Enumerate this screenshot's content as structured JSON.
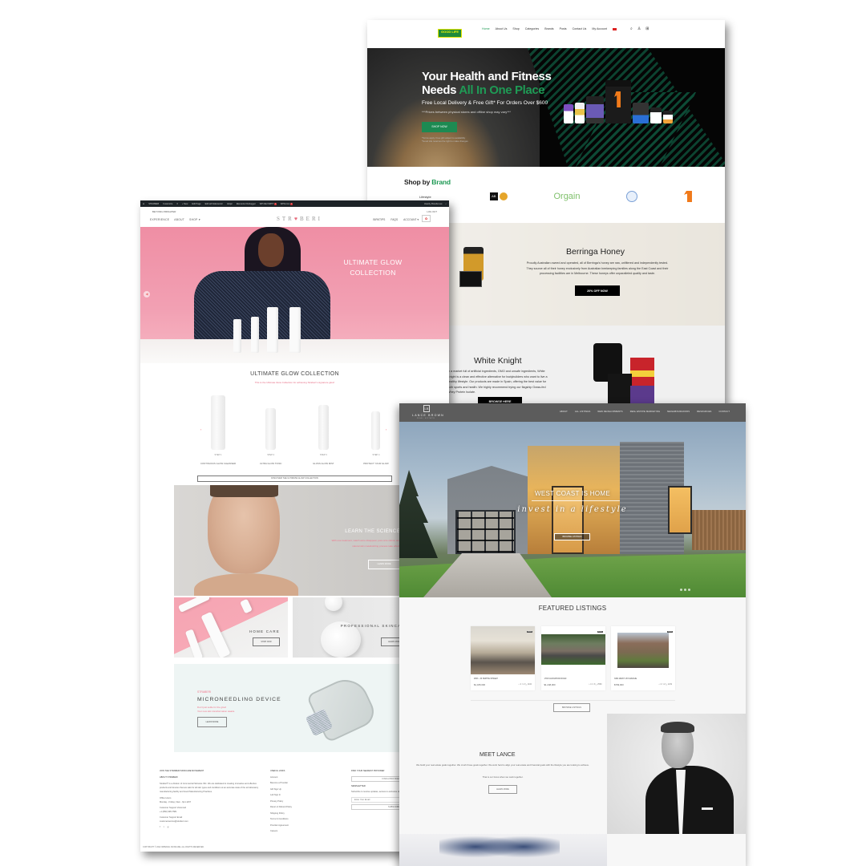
{
  "goodlife": {
    "logo": "GOOD LIFE",
    "nav": [
      "Home",
      "About Us",
      "Shop",
      "Categories",
      "Brands",
      "Posts",
      "Contact Us",
      "My Account"
    ],
    "hero": {
      "title_line1": "Your Health and Fitness",
      "title_line2_plain": "Needs ",
      "title_line2_accent": "All In One Place",
      "subtitle": "Free Local Delivery & Free Gift* For Orders Over $600",
      "note": "***Prices between physical stores and offline shop may vary***",
      "button": "SHOP NOW",
      "fine_print_1": "*Terms apply. Free gift subject to availability",
      "fine_print_2": "*Good Life reserves the right to make changes"
    },
    "shop_by_brand": {
      "plain": "Shop by ",
      "accent": "Brand"
    },
    "brands": [
      "Lifestyle",
      "AB",
      "Star",
      "Orgain",
      "ISSA",
      "Rule 1"
    ],
    "berringa": {
      "title": "Berringa Honey",
      "body": "Proudly Australian owned and operated, all of Berringa's honey are raw, unfiltered and independently tested. They source all of their honey exclusively from Australian beekeeping families along the East Coast and their processing facilities are in Melbourne. These honeys offer unparalleled quality and taste.",
      "button": "20% OFF NOW"
    },
    "white_knight": {
      "title": "White Knight",
      "body": "In a market full of artificial ingredients, GMO and unsafe ingredients, White Knight is a clean and effective alternative for bodybuilders who want to live a healthy lifestyle. Our products are made in Spain, offering the best value for both sports and health. We highly recommend trying our flagship Grass-fed Whey Protein Isolate.",
      "button": "BROWSE HERE"
    },
    "colors": {
      "accent": "#1f9a55",
      "hero_bg": "#050505"
    }
  },
  "straberi": {
    "admin_bar": [
      "STRABERI",
      "Customize",
      "0",
      "+ New",
      "Edit Page",
      "Edit with Elementor",
      "Hotjar",
      "Elementor Debugger",
      "WP Mail SMTP",
      "WPForms"
    ],
    "admin_bar_user": "Howdy, Brenda Lee",
    "tagline": "BEYOND A BRIGHTER",
    "logout": "LOG OUT",
    "nav_left": [
      "EXPERIENCE",
      "ABOUT",
      "SHOP"
    ],
    "logo": "STRABERI",
    "nav_right": [
      "BIRKTIPS",
      "FAQS",
      "ACCOUNT"
    ],
    "hero": {
      "title": "ULTIMATE GLOW COLLECTION"
    },
    "collection": {
      "title": "ULTIMATE GLOW COLLECTION",
      "subtitle": "This is the Ultimate Glow Collection for achieving Straberi's signature glow!",
      "products": [
        {
          "step": "STEP 1",
          "name": "CONTINUOUS GLOW CLEANSER"
        },
        {
          "step": "STEP 2",
          "name": "ULTRA GLOW TONIC"
        },
        {
          "step": "STEP 3",
          "name": "GLOSS GLOW MIST"
        },
        {
          "step": "STEP 4",
          "name": "PROTECT YOUR GLOW"
        }
      ],
      "discover_button": "DISCOVER THE ULTIMATE GLOW COLLECTION"
    },
    "science": {
      "title": "LEARN THE SCIENCE",
      "body": "With one treatment, watch acne disappear, pore size shrink, and natural skin metabolizing process take effect.",
      "button": "LEARN MORE"
    },
    "tiles": [
      {
        "title": "HOME CARE",
        "button": "SHOP NOW"
      },
      {
        "title": "PROFESSIONAL SKINCARE",
        "button": "LEARN MORE"
      }
    ],
    "micro": {
      "brand": "STRABERI",
      "title": "MICRONEEDLING DEVICE",
      "body_1": "Don't just settle for the glow!",
      "body_2": "Your new skin transformation awaits.",
      "button": "LEARN MORE"
    },
    "footer": {
      "join_heading": "JOIN THE STRABERI SKINCARE MOVEMENT",
      "about_heading": "ABOUT STRABERI",
      "about_body": "Straberi® is a division of Commercial Skincare INC. We are dedicated to creating innovative and effective products and devices that are safe for all skin types and conditions at an accurate state of the art laboratory manufacturing facility and Good Manufacturing Practices.",
      "office_hours_label": "Office Hours",
      "office_hours": "Monday - Friday | 9am - 6pm EST",
      "phone_label": "Customer Support Voicemail",
      "phone": "+1 (866) 995-7581",
      "email_label": "Customer Support Email",
      "email": "customerservice@straberi.com",
      "links_heading": "USEFUL LINKS",
      "links": [
        "Account",
        "Become a Provider",
        "Gift Sign Up",
        "Lab Sign In",
        "Privacy Policy",
        "Return & Refund Policy",
        "Shipping Policy",
        "Terms & Conditions",
        "Provider Agreement",
        "Careers"
      ],
      "provider_heading": "FIND YOUR NEAREST PROVIDER",
      "provider_button": "FIND A PROVIDER",
      "newsletter_heading": "NEWSLETTER",
      "newsletter_body": "Subscribe to receive updates, access to exclusive deals",
      "email_placeholder": "Enter Your Email",
      "subscribe_button": "SUBSCRIBE",
      "copyright": "COPYRIGHT © 2022 IMPERIAL SKINCARE. ALL RIGHTS RESERVED."
    },
    "colors": {
      "pink": "#f07389",
      "hero_pink": "#ef8ea4"
    }
  },
  "lance": {
    "logo_mark": "LB",
    "name": "LANCE BROWN",
    "sub": "REAL ESTATE",
    "nav": [
      "ABOUT",
      "ALL LISTINGS",
      "NEW DEVELOPMENTS",
      "REAL ESTATE MARKETING",
      "NEIGHBOURHOODS",
      "RESOURCES",
      "CONTACT"
    ],
    "hero": {
      "title": "WEST COAST IS HOME",
      "script": "invest in a lifestyle",
      "button": "BROWSE LISTINGS"
    },
    "featured_title": "FEATURED LISTINGS",
    "listings": [
      {
        "badge": "SOLD",
        "address": "#303 - 33 SMITHE STREET",
        "price": "$1,325,000",
        "beds": "2",
        "baths": "2",
        "sqft": "1102"
      },
      {
        "badge": "SOLD",
        "address": "1793 CLIFFWOOD ROAD",
        "price": "$1,248,000",
        "beds": "4",
        "baths": "3",
        "sqft": "2560"
      },
      {
        "badge": "SOLD",
        "address": "3364 WEST 1ST AVENUE",
        "price": "$799,000",
        "beds": "2",
        "baths": "2",
        "sqft": "1219"
      }
    ],
    "browse_button": "BROWSE LISTINGS",
    "meet": {
      "title": "MEET LANCE",
      "body": "We build your real estate goals together. We crush those goals together. We work hard to align your real estate and financial goals with the lifestyle you are looking to achieve.",
      "note": "That is our focus when we work together.",
      "button": "LEARN MORE"
    },
    "colors": {
      "header_bg": "#5c5c5c"
    }
  }
}
